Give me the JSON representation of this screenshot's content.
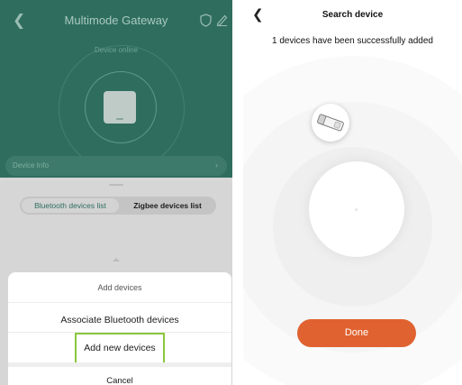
{
  "gateway": {
    "title": "Multimode Gateway",
    "status": "Device online",
    "info_label": "Device Info",
    "back_icon": "chevron-left-icon",
    "shield_icon": "shield-icon",
    "edit_icon": "pencil-icon"
  },
  "device_lists": {
    "tabs": [
      "Bluetooth devices list",
      "Zigbee devices list"
    ]
  },
  "action_sheet": {
    "title": "Add devices",
    "items": [
      "Associate Bluetooth devices",
      "Add new devices"
    ],
    "cancel": "Cancel",
    "highlight_color": "#8cc63e"
  },
  "search_screen": {
    "title": "Search device",
    "message": "1 devices have been successfully added",
    "done_label": "Done",
    "accent": "#e06230"
  },
  "colors": {
    "gateway_bg": "#2f6e5f",
    "panel_bg": "#d6d6d6"
  }
}
